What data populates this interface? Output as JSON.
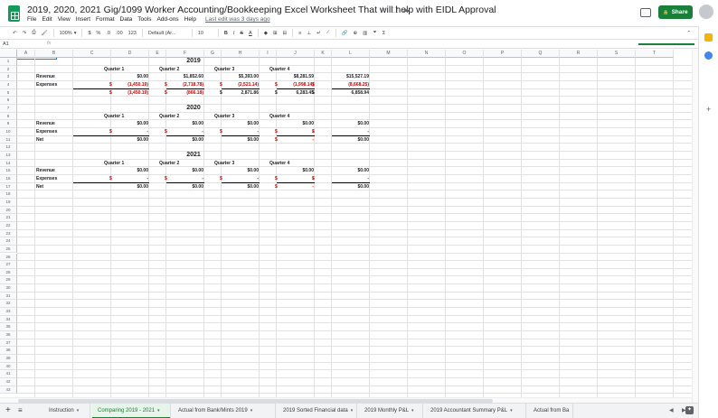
{
  "header": {
    "doc_title": "2019, 2020, 2021 Gig/1099 Worker Accounting/Bookkeeping Excel Worksheet That will help with EIDL Approval",
    "star_icon": "☆",
    "move_icon": "⬚",
    "cloud_icon": "☁",
    "share_label": "Share",
    "lock_icon": "🔒"
  },
  "menu": [
    "File",
    "Edit",
    "View",
    "Insert",
    "Format",
    "Data",
    "Tools",
    "Add-ons",
    "Help"
  ],
  "last_edit": "Last edit was 3 days ago",
  "toolbar": {
    "undo": "↶",
    "redo": "↷",
    "print": "⎙",
    "paint": "🖌",
    "zoom": "100%",
    "zoom_arrow": "▾",
    "currency": "$",
    "percent": "%",
    "dec_less": ".0",
    "dec_more": ".00",
    "format_more": "123",
    "font": "Default (Ar...",
    "font_size": "10",
    "bold": "B",
    "italic": "I",
    "strike": "S",
    "text_color": "A",
    "fill": "◆",
    "borders": "⊞",
    "merge": "⊟",
    "halign": "≡",
    "valign": "⊥",
    "wrap": "↵",
    "rotate": "⟋",
    "link": "🔗",
    "comment": "⊕",
    "chart": "▥",
    "filter": "⏷",
    "functions": "Σ",
    "collapse": "⌃"
  },
  "formula_bar": {
    "namebox": "A1",
    "fx": "fx"
  },
  "columns": [
    "A",
    "B",
    "C",
    "D",
    "E",
    "F",
    "G",
    "H",
    "I",
    "J",
    "K",
    "L",
    "M",
    "N",
    "O",
    "P",
    "Q",
    "R",
    "S",
    "T"
  ],
  "rows": [
    "1",
    "2",
    "3",
    "4",
    "5",
    "6",
    "7",
    "8",
    "9",
    "10",
    "11",
    "12",
    "13",
    "14",
    "15",
    "16",
    "17",
    "18",
    "19",
    "20",
    "21",
    "22",
    "23",
    "24",
    "25",
    "26",
    "27",
    "28",
    "29",
    "30",
    "31",
    "32",
    "33",
    "34",
    "35",
    "36",
    "37",
    "38",
    "39",
    "40",
    "41",
    "42",
    "43"
  ],
  "sheet": {
    "y2019": {
      "year": "2019",
      "quarters": [
        "Quarter 1",
        "Quarter 2",
        "Quarter 3",
        "Quarter 4"
      ],
      "labels": [
        "Revenue",
        "Expenses"
      ],
      "revenue": [
        "$0.00",
        "$1,852.60",
        "$5,393.00",
        "$8,281.59",
        "$15,527.19"
      ],
      "expenses": [
        "(1,450.19)",
        "(2,718.78)",
        "(2,521.14)",
        "(1,998.14)",
        "(8,668.25)"
      ],
      "net": [
        "(1,450.19)",
        "(866.18)",
        "2,871.86",
        "6,283.45",
        "6,858.94"
      ]
    },
    "y2020": {
      "year": "2020",
      "quarters": [
        "Quarter 1",
        "Quarter 2",
        "Quarter 3",
        "Quarter 4"
      ],
      "labels": [
        "Revenue",
        "Expenses",
        "Net"
      ],
      "revenue": [
        "$0.00",
        "$0.00",
        "$0.00",
        "$0.00",
        "$0.00"
      ],
      "expenses": [
        "-",
        "-",
        "-",
        "-",
        "-"
      ],
      "net": [
        "$0.00",
        "$0.00",
        "$0.00",
        "-",
        "$0.00"
      ]
    },
    "y2021": {
      "year": "2021",
      "quarters": [
        "Quarter 1",
        "Quarter 2",
        "Quarter 3",
        "Quarter 4"
      ],
      "labels": [
        "Revenue",
        "Expenses",
        "Net"
      ],
      "revenue": [
        "$0.00",
        "$0.00",
        "$0.00",
        "$0.00",
        "$0.00"
      ],
      "expenses": [
        "-",
        "-",
        "-",
        "-",
        "-"
      ],
      "net": [
        "$0.00",
        "$0.00",
        "$0.00",
        "-",
        "$0.00"
      ]
    },
    "dollar": "$"
  },
  "tabs": {
    "add_icon": "+",
    "list_icon": "≡",
    "items": [
      "Instruction",
      "Comparing 2019 - 2021",
      "Actual from Bank/Mints 2019",
      "2019 Sorted Financial data",
      "2019 Monthly P&L",
      "2019 Accountant Summary P&L",
      "Actual from Ba"
    ],
    "arrow": "▾",
    "scroll_left": "◀",
    "scroll_right": "▶",
    "explore_icon": "✦"
  },
  "colors": {
    "brand_green": "#188038",
    "negative_red": "#cc0000",
    "select_blue": "#1a73e8"
  }
}
